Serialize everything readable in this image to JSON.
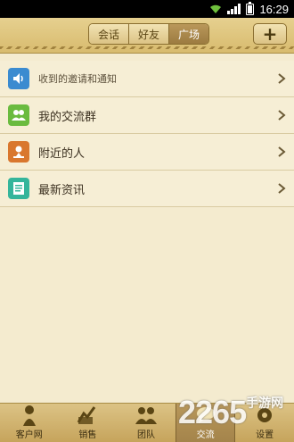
{
  "status_bar": {
    "time": "16:29"
  },
  "header": {
    "tabs": [
      {
        "label": "会话",
        "active": false
      },
      {
        "label": "好友",
        "active": false
      },
      {
        "label": "广场",
        "active": true
      }
    ],
    "add_label": "+"
  },
  "list": [
    {
      "label": "收到的邀请和通知",
      "icon": "speaker-icon",
      "color": "#3b8bd0"
    },
    {
      "label": "我的交流群",
      "icon": "group-icon",
      "color": "#6abb3f"
    },
    {
      "label": "附近的人",
      "icon": "location-pin-icon",
      "color": "#d9772e"
    },
    {
      "label": "最新资讯",
      "icon": "news-icon",
      "color": "#35b59b"
    }
  ],
  "bottom_nav": [
    {
      "label": "客户网",
      "icon": "customer-icon",
      "active": false
    },
    {
      "label": "销售",
      "icon": "sales-icon",
      "active": false
    },
    {
      "label": "团队",
      "icon": "team-icon",
      "active": false
    },
    {
      "label": "交流",
      "icon": "chat-icon",
      "active": true
    },
    {
      "label": "设置",
      "icon": "settings-icon",
      "active": false
    }
  ],
  "watermark": {
    "number": "2265",
    "suffix": "手游网"
  }
}
